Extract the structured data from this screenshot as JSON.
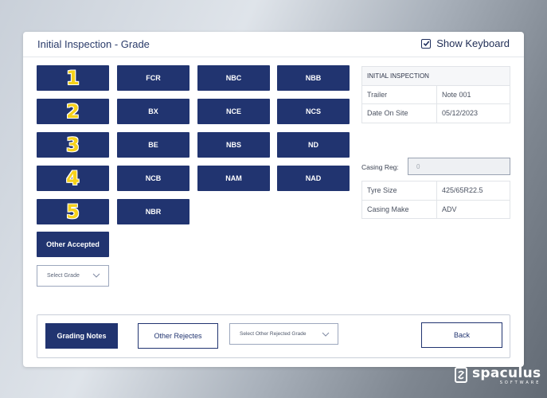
{
  "header": {
    "title": "Initial Inspection - Grade",
    "show_keyboard_label": "Show Keyboard",
    "show_keyboard_checked": true
  },
  "grade_rows": [
    {
      "number": "1",
      "codes": [
        "FCR",
        "NBC",
        "NBB"
      ]
    },
    {
      "number": "2",
      "codes": [
        "BX",
        "NCE",
        "NCS"
      ]
    },
    {
      "number": "3",
      "codes": [
        "BE",
        "NBS",
        "ND"
      ]
    },
    {
      "number": "4",
      "codes": [
        "NCB",
        "NAM",
        "NAD"
      ]
    },
    {
      "number": "5",
      "codes": [
        "NBR"
      ]
    }
  ],
  "other_accepted_label": "Other Accepted",
  "select_grade_placeholder": "Select Grade",
  "inspection_info": {
    "heading": "INITIAL INSPECTION",
    "rows": [
      {
        "label": "Trailer",
        "value": "Note 001"
      },
      {
        "label": "Date On Site",
        "value": "05/12/2023"
      }
    ]
  },
  "casing": {
    "reg_label": "Casing Reg:",
    "reg_value": "0",
    "rows": [
      {
        "label": "Tyre Size",
        "value": "425/65R22.5"
      },
      {
        "label": "Casing Make",
        "value": "ADV"
      }
    ]
  },
  "footer": {
    "grading_notes_label": "Grading Notes",
    "other_rejects_label": "Other Rejectes",
    "select_rejected_placeholder": "Select Other Rejected Grade",
    "back_label": "Back"
  },
  "brand": {
    "name": "spaculus",
    "sub": "SOFTWARE"
  },
  "colors": {
    "primary": "#213470",
    "number_yellow": "#f6d21a"
  }
}
